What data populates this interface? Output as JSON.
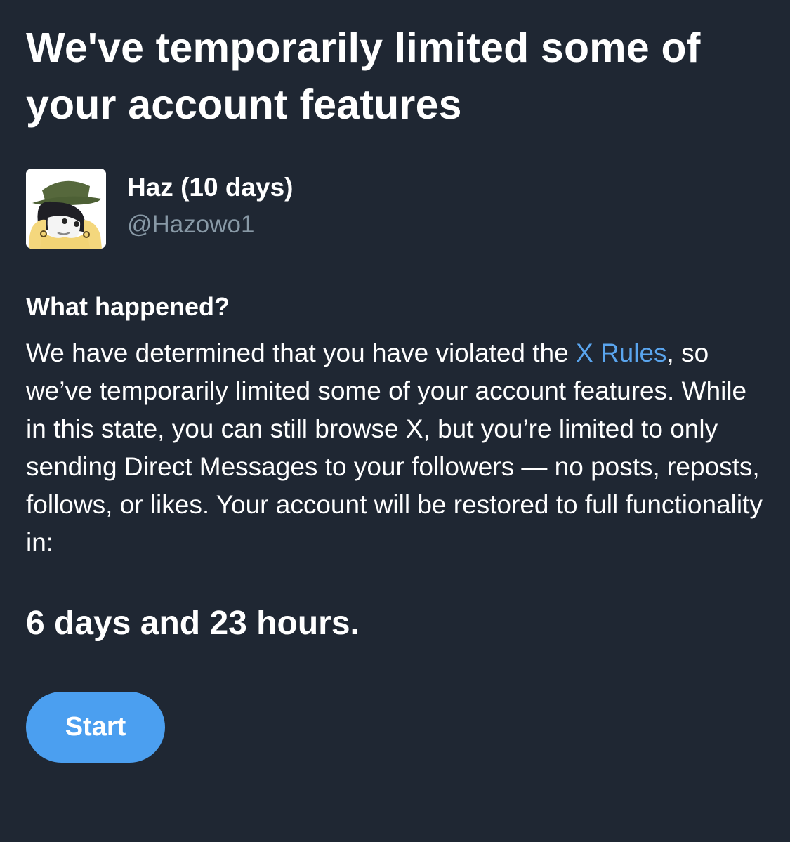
{
  "dialog": {
    "title": "We've temporarily limited some of your account features"
  },
  "account": {
    "display_name": "Haz (10 days)",
    "handle": "@Hazowo1",
    "avatar_icon": "anime-character-avatar"
  },
  "explanation": {
    "heading": "What happened?",
    "text_before_link": "We have determined that you have violated the ",
    "link_text": "X Rules",
    "text_after_link": ", so we’ve temporarily limited some of your account features. While in this state, you can still browse X, but you’re limited to only sending Direct Messages to your followers — no posts, reposts, follows, or likes. Your account will be restored to full functionality in:"
  },
  "countdown": "6 days and 23 hours.",
  "actions": {
    "start_label": "Start"
  },
  "colors": {
    "background": "#1f2733",
    "link": "#5aa5ee",
    "button": "#4b9ff0",
    "secondary_text": "#8899a6"
  }
}
